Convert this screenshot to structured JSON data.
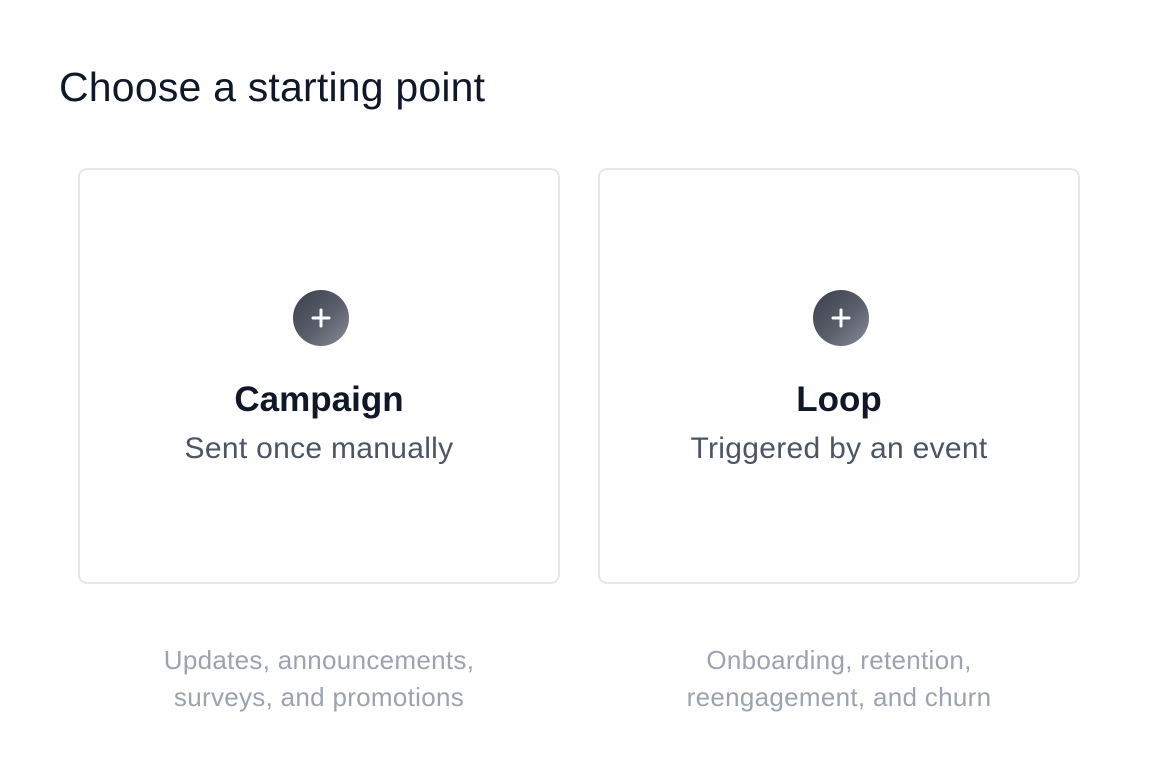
{
  "header": {
    "title": "Choose a starting point"
  },
  "options": [
    {
      "title": "Campaign",
      "subtitle": "Sent once manually",
      "description_lines": [
        "Updates, announcements,",
        "surveys, and promotions"
      ],
      "icon": "plus-icon"
    },
    {
      "title": "Loop",
      "subtitle": "Triggered by an event",
      "description_lines": [
        "Onboarding, retention,",
        "reengagement, and churn"
      ],
      "icon": "plus-icon"
    }
  ],
  "colors": {
    "title": "#101828",
    "subtitle": "#4b5563",
    "description": "#9ca3af",
    "card_border": "#e5e7eb",
    "icon_bg": "#4b4f5c",
    "icon_fg": "#ffffff"
  }
}
